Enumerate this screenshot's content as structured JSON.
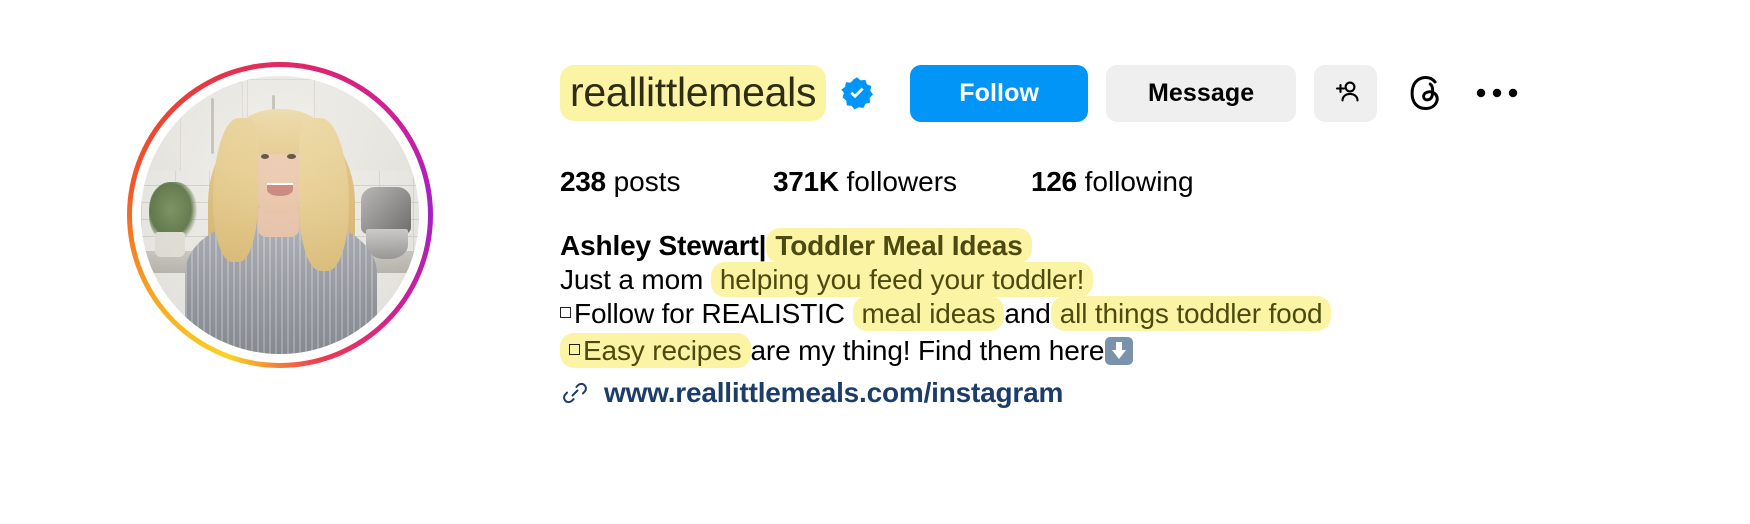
{
  "profile": {
    "username": "reallittlemeals",
    "verified_icon": "verified-badge-icon",
    "avatar_alt": "profile-photo",
    "story_ring_colors": [
      "#f9d423",
      "#f05a28",
      "#e0246b",
      "#a420c6"
    ]
  },
  "actions": {
    "follow_label": "Follow",
    "follow_color": "#0095F6",
    "message_label": "Message",
    "message_color": "#EFEFEF",
    "add_person_icon": "add-person-icon",
    "threads_icon": "threads-icon",
    "more_icon": "more-options-icon"
  },
  "stats": {
    "posts": {
      "value": "238",
      "label": "posts"
    },
    "followers": {
      "value": "371K",
      "label": "followers"
    },
    "following": {
      "value": "126",
      "label": "following"
    }
  },
  "bio": {
    "line1": {
      "name": "Ashley Stewart|",
      "highlight": "Toddler Meal Ideas"
    },
    "line2": {
      "plain": "Just a mom",
      "highlight": "helping you feed your toddler!"
    },
    "line3": {
      "plain1": "Follow for REALISTIC",
      "highlight1": "meal ideas",
      "plain2": "and",
      "highlight2": "all things toddler food"
    },
    "line4": {
      "highlight": "Easy recipes",
      "plain": "are my thing! Find them here",
      "emoji": "down-arrow-emoji"
    }
  },
  "link": {
    "icon": "link-chain-icon",
    "url_text": "www.reallittlemeals.com/instagram",
    "color": "#1C3D6B"
  },
  "highlight_color": "#FBF4A4"
}
